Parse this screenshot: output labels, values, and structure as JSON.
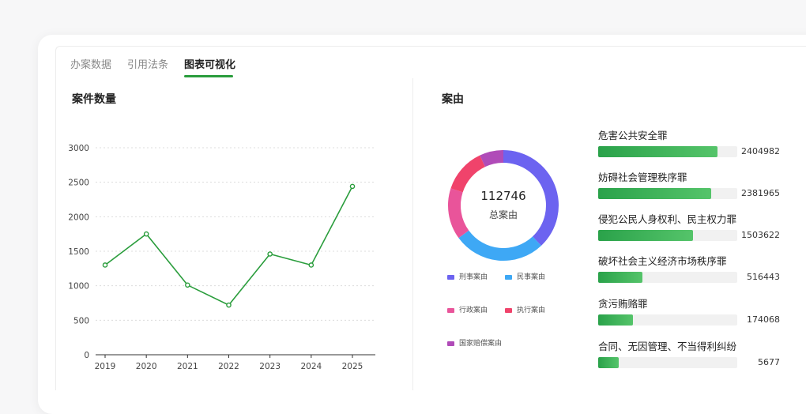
{
  "tabs": [
    {
      "label": "办案数据",
      "active": false
    },
    {
      "label": "引用法条",
      "active": false
    },
    {
      "label": "图表可视化",
      "active": true
    }
  ],
  "case_count": {
    "title": "案件数量",
    "chart_data": {
      "type": "line",
      "x": [
        "2019",
        "2020",
        "2021",
        "2022",
        "2023",
        "2024",
        "2025"
      ],
      "series": [
        {
          "values": [
            1300,
            1750,
            1010,
            720,
            1460,
            1300,
            2440
          ]
        }
      ],
      "ylim": [
        0,
        3000
      ],
      "yticks": [
        0,
        500,
        1000,
        1500,
        2000,
        2500,
        3000
      ],
      "grid": true,
      "color": "#2a9d3c"
    }
  },
  "case_cause": {
    "title": "案由",
    "donut": {
      "total": "112746",
      "center_label": "总案由",
      "chart_data": {
        "type": "pie",
        "categories": [
          "刑事案由",
          "民事案由",
          "行政案由",
          "执行案由",
          "国家赔偿案由"
        ],
        "values": [
          38,
          27,
          15,
          13,
          7
        ],
        "colors": [
          "#6c63f0",
          "#3ea8f5",
          "#e9549a",
          "#f0436b",
          "#b04bb8"
        ]
      }
    },
    "ranking": {
      "chart_data": {
        "type": "bar",
        "categories": [
          "危害公共安全罪",
          "妨碍社会管理秩序罪",
          "侵犯公民人身权利、民主权力罪",
          "破坏社会主义经济市场秩序罪",
          "贪污贿赂罪",
          "合同、无因管理、不当得利纠纷"
        ],
        "values": [
          2404982,
          2381965,
          1503622,
          516443,
          174068,
          5677
        ],
        "value_labels": [
          "2404982",
          "2381965",
          "1503622",
          "516443",
          "174068",
          "5677"
        ],
        "bar_fraction": [
          0.86,
          0.81,
          0.68,
          0.32,
          0.25,
          0.15
        ]
      }
    }
  }
}
